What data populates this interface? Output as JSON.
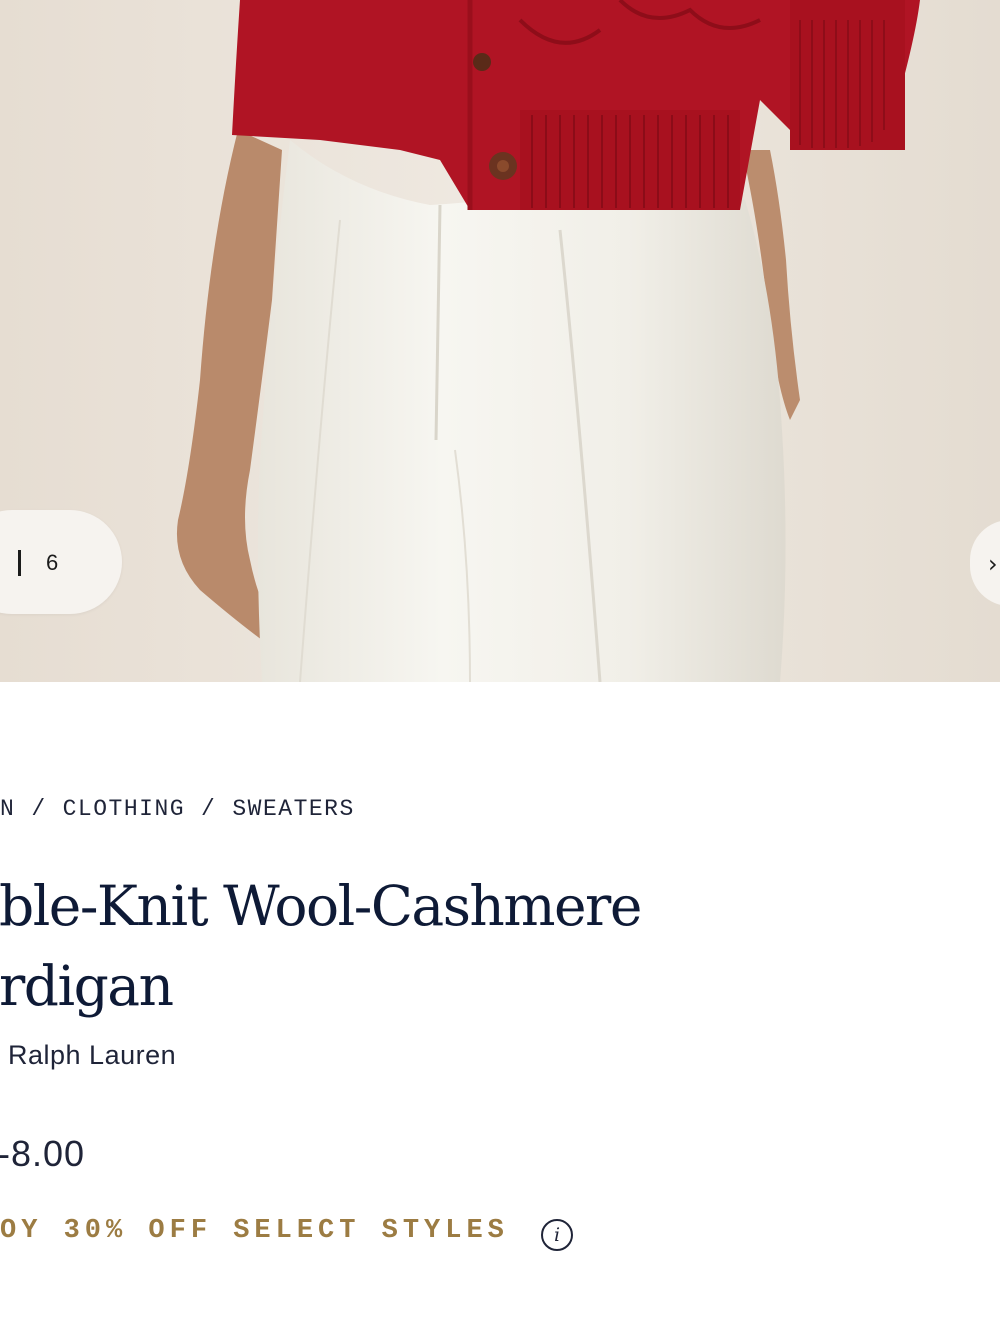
{
  "gallery": {
    "image_alt_subject": "model wearing red cable-knit cardigan and white pleated trousers",
    "counter_total": "6",
    "next_icon": "chevron-right-icon"
  },
  "breadcrumb": {
    "items": [
      "N",
      "CLOTHING",
      "SWEATERS"
    ],
    "separator": "/"
  },
  "product": {
    "title_line1": "ble-Knit Wool-Cashmere",
    "title_line2": "rdigan",
    "brand": "Ralph Lauren",
    "price": "-8.00"
  },
  "promo": {
    "text": "OY 30% OFF SELECT STYLES",
    "info_icon": "info-icon",
    "info_glyph": "i"
  },
  "colors": {
    "title": "#0e1a36",
    "promo": "#9c7c43",
    "cardigan": "#b01424",
    "trousers": "#f3f1ea",
    "backdrop": "#ece5dc"
  }
}
